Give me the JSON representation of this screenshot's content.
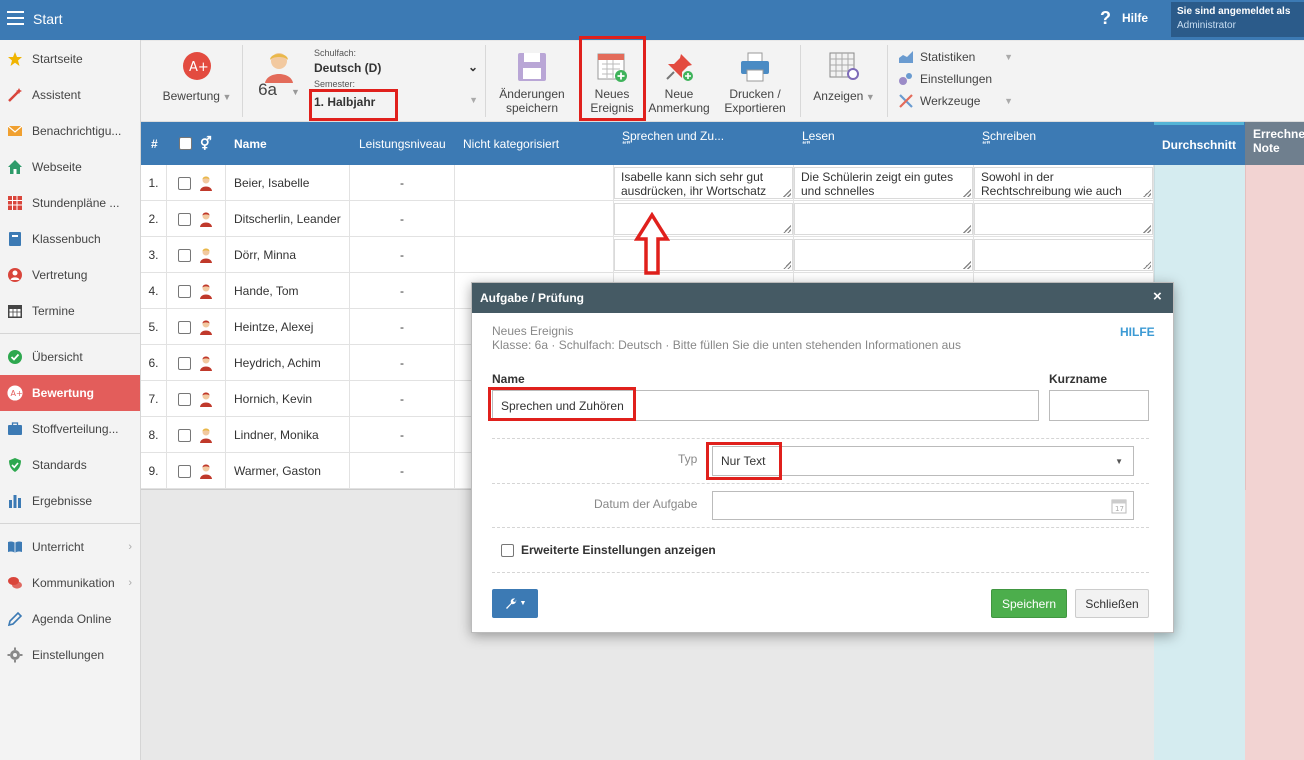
{
  "topbar": {
    "title": "Start",
    "help_label": "Hilfe",
    "user_line1": "Sie sind angemeldet als",
    "user_line2": "Administrator"
  },
  "sidebar": {
    "items": [
      {
        "label": "Startseite"
      },
      {
        "label": "Assistent"
      },
      {
        "label": "Benachrichtigu..."
      },
      {
        "label": "Webseite"
      },
      {
        "label": "Stundenpläne ..."
      },
      {
        "label": "Klassenbuch"
      },
      {
        "label": "Vertretung"
      },
      {
        "label": "Termine"
      },
      {
        "label": "Übersicht"
      },
      {
        "label": "Bewertung",
        "active": true
      },
      {
        "label": "Stoffverteilung..."
      },
      {
        "label": "Standards"
      },
      {
        "label": "Ergebnisse"
      },
      {
        "label": "Unterricht"
      },
      {
        "label": "Kommunikation"
      },
      {
        "label": "Agenda Online"
      },
      {
        "label": "Einstellungen"
      }
    ]
  },
  "toolbar": {
    "bewertung_label": "Bewertung",
    "class_name": "6a",
    "subject_caption": "Schulfach:",
    "subject_value": "Deutsch (D)",
    "semester_caption": "Semester:",
    "semester_value": "1. Halbjahr",
    "save_changes_line1": "Änderungen",
    "save_changes_line2": "speichern",
    "new_event_line1": "Neues",
    "new_event_line2": "Ereignis",
    "new_note_line1": "Neue",
    "new_note_line2": "Anmerkung",
    "print_line1": "Drucken /",
    "print_line2": "Exportieren",
    "display_label": "Anzeigen",
    "statistics_label": "Statistiken",
    "settings_label": "Einstellungen",
    "tools_label": "Werkzeuge"
  },
  "table": {
    "headers": {
      "num": "#",
      "name": "Name",
      "level": "Leistungsniveau",
      "uncat": "Nicht kategorisiert",
      "speaking": "Sprechen und Zu...",
      "reading": "Lesen",
      "writing": "Schreiben",
      "quote_mark": "❝❞",
      "average": "Durchschnitt",
      "grade_line1": "Errechne",
      "grade_line2": "Note"
    },
    "rows": [
      {
        "num": "1.",
        "name": "Beier, Isabelle",
        "level": "-",
        "gender": "f",
        "speaking": "Isabelle kann sich sehr gut ausdrücken, ihr Wortschatz",
        "reading": "Die Schülerin zeigt ein gutes und schnelles",
        "writing": "Sowohl in der Rechtschreibung wie auch"
      },
      {
        "num": "2.",
        "name": "Ditscherlin, Leander",
        "level": "-",
        "gender": "m",
        "speaking": "",
        "reading": "",
        "writing": ""
      },
      {
        "num": "3.",
        "name": "Dörr, Minna",
        "level": "-",
        "gender": "f",
        "speaking": "",
        "reading": "",
        "writing": ""
      },
      {
        "num": "4.",
        "name": "Hande, Tom",
        "level": "-",
        "gender": "m"
      },
      {
        "num": "5.",
        "name": "Heintze, Alexej",
        "level": "-",
        "gender": "m"
      },
      {
        "num": "6.",
        "name": "Heydrich, Achim",
        "level": "-",
        "gender": "m"
      },
      {
        "num": "7.",
        "name": "Hornich, Kevin",
        "level": "-",
        "gender": "m"
      },
      {
        "num": "8.",
        "name": "Lindner, Monika",
        "level": "-",
        "gender": "f"
      },
      {
        "num": "9.",
        "name": "Warmer, Gaston",
        "level": "-",
        "gender": "m"
      }
    ]
  },
  "modal": {
    "title": "Aufgabe / Prüfung",
    "close": "×",
    "subtitle": "Neues Ereignis",
    "info": "Klasse: 6a · Schulfach: Deutsch · Bitte füllen Sie die unten stehenden Informationen aus",
    "help_link": "HILFE",
    "name_label": "Name",
    "name_value": "Sprechen und Zuhören",
    "short_label": "Kurzname",
    "short_value": "",
    "type_label": "Typ",
    "type_value": "Nur Text",
    "date_label": "Datum der Aufgabe",
    "date_value": "",
    "calendar_day": "17",
    "advanced_label": "Erweiterte Einstellungen anzeigen",
    "save_button": "Speichern",
    "close_button": "Schließen"
  },
  "colors": {
    "header_blue": "#3c7ab4",
    "active_red": "#e35d5b",
    "highlight_red": "#e0201c",
    "save_green": "#4cae4c",
    "modal_head": "#455a64"
  }
}
